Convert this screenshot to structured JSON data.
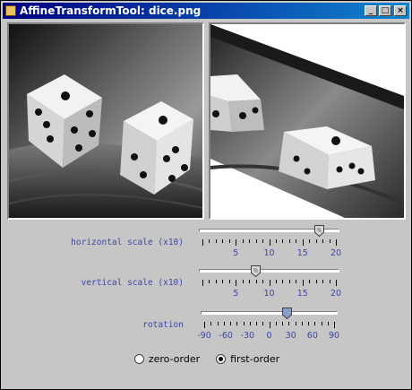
{
  "window": {
    "title": "AffineTransformTool: dice.png",
    "buttons": [
      "_",
      "□",
      "×"
    ]
  },
  "images": {
    "left_name": "original-image",
    "right_name": "transformed-image"
  },
  "sliders": [
    {
      "id": "horizontal",
      "label": "horizontal scale (x10)",
      "min": 0,
      "max": 20,
      "value": 17.5,
      "major_ticks": [
        5,
        10,
        15,
        20
      ],
      "tick_labels": [
        "5",
        "10",
        "15",
        "20"
      ]
    },
    {
      "id": "vertical",
      "label": "vertical scale (x10)",
      "min": 0,
      "max": 20,
      "value": 8,
      "major_ticks": [
        5,
        10,
        15,
        20
      ],
      "tick_labels": [
        "5",
        "10",
        "15",
        "20"
      ]
    },
    {
      "id": "rotation",
      "label": "rotation",
      "min": -90,
      "max": 90,
      "value": 25,
      "major_ticks": [
        -90,
        -60,
        -30,
        0,
        30,
        60,
        90
      ],
      "tick_labels": [
        "-90",
        "-60",
        "-30",
        "0",
        "30",
        "60",
        "90"
      ]
    }
  ],
  "interpolation": {
    "options": [
      {
        "label": "zero-order",
        "selected": false
      },
      {
        "label": "first-order",
        "selected": true
      }
    ]
  },
  "colors": {
    "label_blue": "#3c46a8",
    "title_bar": "#000080",
    "background": "#c6c6c6"
  }
}
